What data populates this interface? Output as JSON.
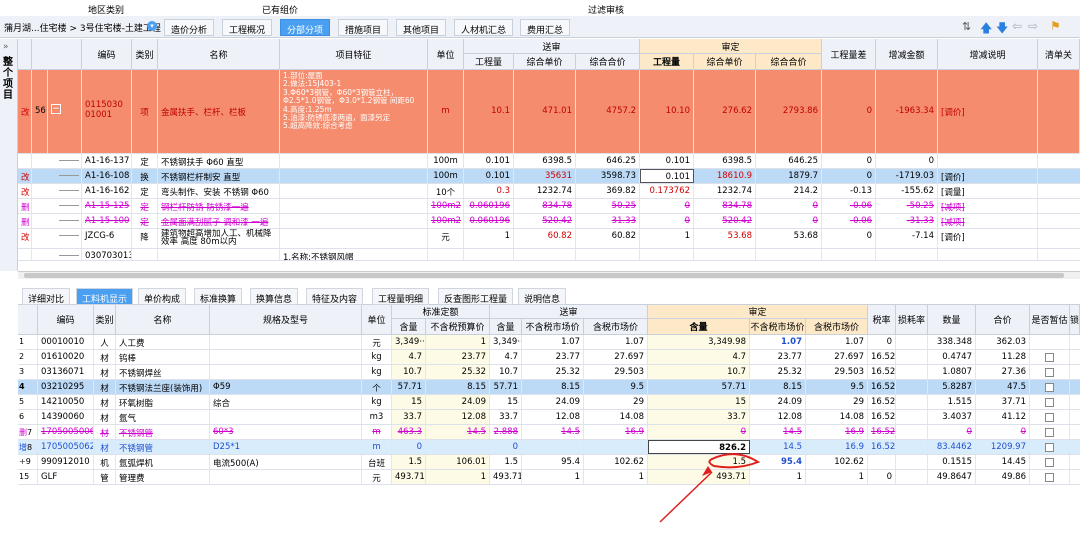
{
  "topstrip": {
    "a": "地区类别",
    "b": "已有组价",
    "c": "过滤审核"
  },
  "tabbar": {
    "breadcrumb": "蒲月湖...住宅楼 > 3号住宅楼-土建工程",
    "tabs": [
      "造价分析",
      "工程概况",
      "分部分项",
      "措施项目",
      "其他项目",
      "人材机汇总",
      "费用汇总"
    ],
    "active_tab": "分部分项"
  },
  "sidebar": {
    "collapse": "»",
    "label": "整个项目"
  },
  "grid1": {
    "headers": {
      "code": "编码",
      "type": "类别",
      "name": "名称",
      "feature": "项目特征",
      "unit": "单位",
      "send": "送审",
      "send_qty": "工程量",
      "send_price": "综合单价",
      "send_total": "综合合价",
      "audit": "审定",
      "audit_qty": "工程量",
      "audit_price": "综合单价",
      "audit_total": "综合合价",
      "diff": "工程量差",
      "incdec": "增减金额",
      "incdec_note": "增减说明",
      "clear": "清单关"
    },
    "main_row": {
      "mark": "改",
      "num": "56",
      "code": "011503001001",
      "type": "项",
      "name": "金属扶手、栏杆、栏板",
      "feature": "1.部位:屋面\n2.做法:15J403-1\n3.Φ60*3钢管，Φ60*3钢管立柱，Φ2.5*1.0钢管，Φ3.0*1.2钢管 间距60\n4.高度:1.25m\n5.油漆:防锈底漆两遍，面漆另定\n5.超高降效:综合考虑",
      "unit": "m",
      "send_qty": "10.1",
      "send_price": "471.01",
      "send_total": "4757.2",
      "audit_qty": "10.10",
      "audit_price": "276.62",
      "audit_total": "2793.86",
      "diff": "0",
      "incdec": "-1963.34",
      "note": "[调价]"
    },
    "rows": [
      {
        "mark": "",
        "code": "A1-16-137",
        "type": "定",
        "name": "不锈钢扶手 Φ60 直型",
        "unit": "100m",
        "sq": "0.101",
        "sp": "6398.5",
        "st": "646.25",
        "aq": "0.101",
        "ap": "6398.5",
        "at": "646.25",
        "diff": "0",
        "inc": "0",
        "note": "",
        "style": "normal"
      },
      {
        "mark": "改",
        "code": "A1-16-108",
        "type": "换",
        "name": "不锈钢栏杆制安 直型",
        "unit": "100m",
        "sq": "0.101",
        "sp": "35631",
        "st": "3598.73",
        "aq": "0.101",
        "ap": "18610.9",
        "at": "1879.7",
        "diff": "0",
        "inc": "-1719.03",
        "note": "[调价]",
        "style": "selected"
      },
      {
        "mark": "改",
        "code": "A1-16-162",
        "type": "定",
        "name": "弯头制作、安装 不锈钢 Φ60",
        "unit": "10个",
        "sq": "0.3",
        "sp": "1232.74",
        "st": "369.82",
        "aq": "0.173762",
        "ap": "1232.74",
        "at": "214.2",
        "diff": "-0.13",
        "inc": "-155.62",
        "note": "[调量]",
        "style": "normal"
      },
      {
        "mark": "删",
        "code": "A1-15-125",
        "type": "定",
        "name": "钢栏杆防锈 防锈漆一遍",
        "unit": "100m2",
        "sq": "0.060196",
        "sp": "834.78",
        "st": "50.25",
        "aq": "0",
        "ap": "834.78",
        "at": "0",
        "diff": "-0.06",
        "inc": "-50.25",
        "note": "[减项]",
        "style": "deleted"
      },
      {
        "mark": "删",
        "code": "A1-15-100",
        "type": "定",
        "name": "金属面满刮腻子 调和漆 一遍",
        "unit": "100m2",
        "sq": "0.060196",
        "sp": "520.42",
        "st": "31.33",
        "aq": "0",
        "ap": "520.42",
        "at": "0",
        "diff": "-0.06",
        "inc": "-31.33",
        "note": "[减项]",
        "style": "deleted"
      },
      {
        "mark": "改",
        "code": "JZCG-6",
        "type": "降",
        "name": "建筑物超高增加人工、机械降效率 高度 80m以内",
        "unit": "元",
        "sq": "1",
        "sp": "60.82",
        "st": "60.82",
        "aq": "1",
        "ap": "53.68",
        "at": "53.68",
        "diff": "0",
        "inc": "-7.14",
        "note": "[调价]",
        "style": "normal"
      },
      {
        "mark": "",
        "code": "030703013001",
        "type": "",
        "name": "",
        "unit": "",
        "sq": "",
        "sp": "",
        "st": "",
        "aq": "",
        "ap": "",
        "at": "",
        "diff": "",
        "inc": "",
        "note": "",
        "feature": "1.名称:不锈钢风帽",
        "style": "partial"
      }
    ]
  },
  "tabs2": [
    "详细对比",
    "工料机显示",
    "单价构成",
    "标准换算",
    "换算信息",
    "特征及内容",
    "工程量明细",
    "反查图形工程量",
    "说明信息"
  ],
  "tabs2_active": "工料机显示",
  "grid2": {
    "headers": {
      "code": "编码",
      "type": "类别",
      "name": "名称",
      "spec": "规格及型号",
      "unit": "单位",
      "quota": "标准定额",
      "q_qty": "含量",
      "q_price": "不含税预算价",
      "send": "送审",
      "s_qty": "含量",
      "s_market": "不含税市场价",
      "s_tax": "含税市场价",
      "audit": "审定",
      "a_qty": "含量",
      "a_market": "不含税市场价",
      "a_tax": "含税市场价",
      "tax": "税率",
      "loss": "损耗率",
      "amount": "数量",
      "total": "合价",
      "tmp": "是否暂估",
      "lock": "锁"
    },
    "rows": [
      {
        "n": "1",
        "code": "00010010",
        "type": "人",
        "name": "人工费",
        "spec": "",
        "unit": "元",
        "qq": "3,349···",
        "qp": "1",
        "sq": "3,349···",
        "sm": "1.07",
        "st": "1.07",
        "aq": "3,349.98",
        "am": "1.07",
        "at": "1.07",
        "tax": "0",
        "loss": "",
        "amt": "338.348",
        "tot": "362.03",
        "cb": false,
        "style": "normal"
      },
      {
        "n": "2",
        "code": "01610020",
        "type": "材",
        "name": "钨棒",
        "spec": "",
        "unit": "kg",
        "qq": "4.7",
        "qp": "23.77",
        "sq": "4.7",
        "sm": "23.77",
        "st": "27.697",
        "aq": "4.7",
        "am": "23.77",
        "at": "27.697",
        "tax": "16.52",
        "loss": "",
        "amt": "0.4747",
        "tot": "11.28",
        "cb": true,
        "style": "normal"
      },
      {
        "n": "3",
        "code": "03136071",
        "type": "材",
        "name": "不锈钢焊丝",
        "spec": "",
        "unit": "kg",
        "qq": "10.7",
        "qp": "25.32",
        "sq": "10.7",
        "sm": "25.32",
        "st": "29.503",
        "aq": "10.7",
        "am": "25.32",
        "at": "29.503",
        "tax": "16.52",
        "loss": "",
        "amt": "1.0807",
        "tot": "27.36",
        "cb": true,
        "style": "normal"
      },
      {
        "n": "4",
        "code": "03210295",
        "type": "材",
        "name": "不锈钢法兰座(装饰用)",
        "spec": "Φ59",
        "unit": "个",
        "qq": "57.71",
        "qp": "8.15",
        "sq": "57.71",
        "sm": "8.15",
        "st": "9.5",
        "aq": "57.71",
        "am": "8.15",
        "at": "9.5",
        "tax": "16.52",
        "loss": "",
        "amt": "5.8287",
        "tot": "47.5",
        "cb": true,
        "style": "selected"
      },
      {
        "n": "5",
        "code": "14210050",
        "type": "材",
        "name": "环氧树脂",
        "spec": "综合",
        "unit": "kg",
        "qq": "15",
        "qp": "24.09",
        "sq": "15",
        "sm": "24.09",
        "st": "29",
        "aq": "15",
        "am": "24.09",
        "at": "29",
        "tax": "16.52",
        "loss": "",
        "amt": "1.515",
        "tot": "37.71",
        "cb": true,
        "style": "normal"
      },
      {
        "n": "6",
        "code": "14390060",
        "type": "材",
        "name": "氩气",
        "spec": "",
        "unit": "m3",
        "qq": "33.7",
        "qp": "12.08",
        "sq": "33.7",
        "sm": "12.08",
        "st": "14.08",
        "aq": "33.7",
        "am": "12.08",
        "at": "14.08",
        "tax": "16.52",
        "loss": "",
        "amt": "3.4037",
        "tot": "41.12",
        "cb": true,
        "style": "normal"
      },
      {
        "n": "7",
        "mark": "删",
        "code": "17050050061",
        "type": "材",
        "name": "不锈钢管",
        "spec": "60*3",
        "unit": "m",
        "qq": "463.3",
        "qp": "14.5",
        "sq": "2.888",
        "sm": "14.5",
        "st": "16.9",
        "aq": "0",
        "am": "14.5",
        "at": "16.9",
        "tax": "16.52",
        "loss": "",
        "amt": "0",
        "tot": "0",
        "cb": true,
        "style": "deleted"
      },
      {
        "n": "8",
        "mark": "增",
        "code": "1705005062",
        "type": "材",
        "name": "不锈钢管",
        "spec": "D25*1",
        "unit": "m",
        "qq": "0",
        "qp": "",
        "sq": "0",
        "sm": "",
        "st": "",
        "aq": "826.2",
        "am": "14.5",
        "at": "16.9",
        "tax": "16.52",
        "loss": "",
        "amt": "83.4462",
        "tot": "1209.97",
        "cb": true,
        "style": "added"
      },
      {
        "n": "9",
        "mark": "+",
        "code": "990912010",
        "type": "机",
        "name": "氩弧焊机",
        "spec": "电流500(A)",
        "unit": "台班",
        "qq": "1.5",
        "qp": "106.01",
        "sq": "1.5",
        "sm": "95.4",
        "st": "102.62",
        "aq": "1.5",
        "am": "95.4",
        "at": "102.62",
        "tax": "",
        "loss": "",
        "amt": "0.1515",
        "tot": "14.45",
        "cb": true,
        "style": "normal"
      },
      {
        "n": "15",
        "code": "GLF",
        "type": "管",
        "name": "管理费",
        "spec": "",
        "unit": "元",
        "qq": "493.71",
        "qp": "1",
        "sq": "493.71",
        "sm": "1",
        "st": "1",
        "aq": "493.71",
        "am": "1",
        "at": "1",
        "tax": "0",
        "loss": "",
        "amt": "49.8647",
        "tot": "49.86",
        "cb": true,
        "style": "normal"
      }
    ]
  },
  "colors": {
    "accent": "#4a9ff0",
    "main_row": "#f58c6e",
    "selected_row": "#bcd9f6",
    "highlight_header": "#fde9c8",
    "annotation": "#e02020"
  }
}
